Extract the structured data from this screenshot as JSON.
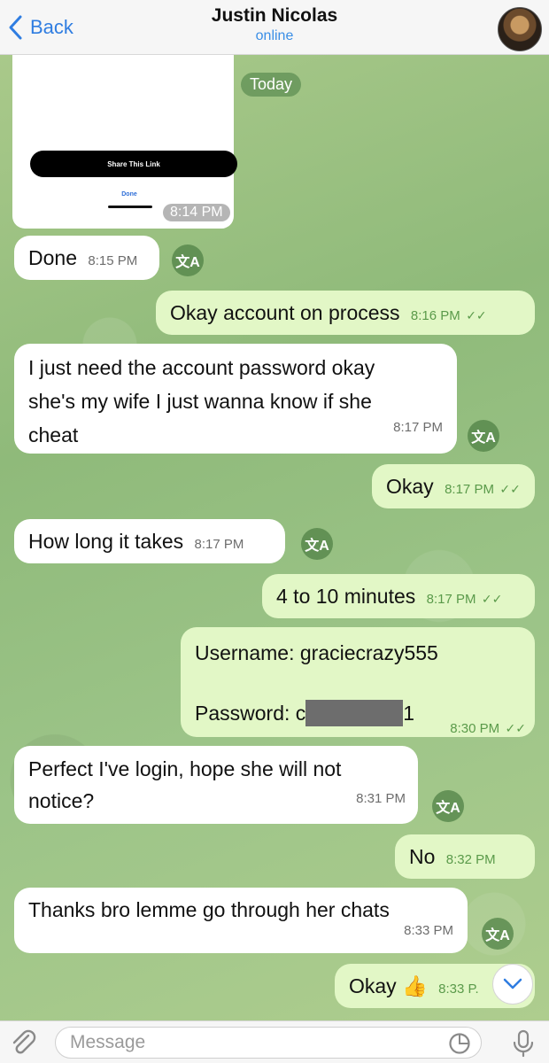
{
  "header": {
    "back_label": "Back",
    "contact_name": "Justin Nicolas",
    "status": "online"
  },
  "date_divider": "Today",
  "image_message": {
    "button_label": "Share This Link",
    "done_label": "Done",
    "time": "8:14 PM"
  },
  "messages": [
    {
      "text": "Done",
      "time": "8:15 PM"
    },
    {
      "text": "Okay account on process",
      "time": "8:16 PM"
    },
    {
      "line1": "I just need the account password okay",
      "line2": "she's my wife I just wanna know if she",
      "line3": "cheat",
      "time": "8:17 PM"
    },
    {
      "text": "Okay",
      "time": "8:17 PM"
    },
    {
      "text": "How long it takes",
      "time": "8:17 PM"
    },
    {
      "text": "4 to 10 minutes",
      "time": "8:17 PM"
    },
    {
      "username_line": "Username: graciecrazy555",
      "password_prefix": "Password: c",
      "password_suffix": "1",
      "time": "8:30 PM"
    },
    {
      "line1": "Perfect I've login, hope she will not",
      "line2": "notice?",
      "time": "8:31 PM"
    },
    {
      "text": "No",
      "time": "8:32 PM"
    },
    {
      "text": "Thanks bro lemme go through her chats",
      "time": "8:33 PM"
    },
    {
      "text": "Okay 👍",
      "time": "8:33 P."
    }
  ],
  "translate_label": "文A",
  "tick": "✓✓",
  "input": {
    "placeholder": "Message"
  },
  "colors": {
    "accent": "#2f7de1",
    "incoming": "#ffffff",
    "outgoing": "#e2f7c6"
  }
}
